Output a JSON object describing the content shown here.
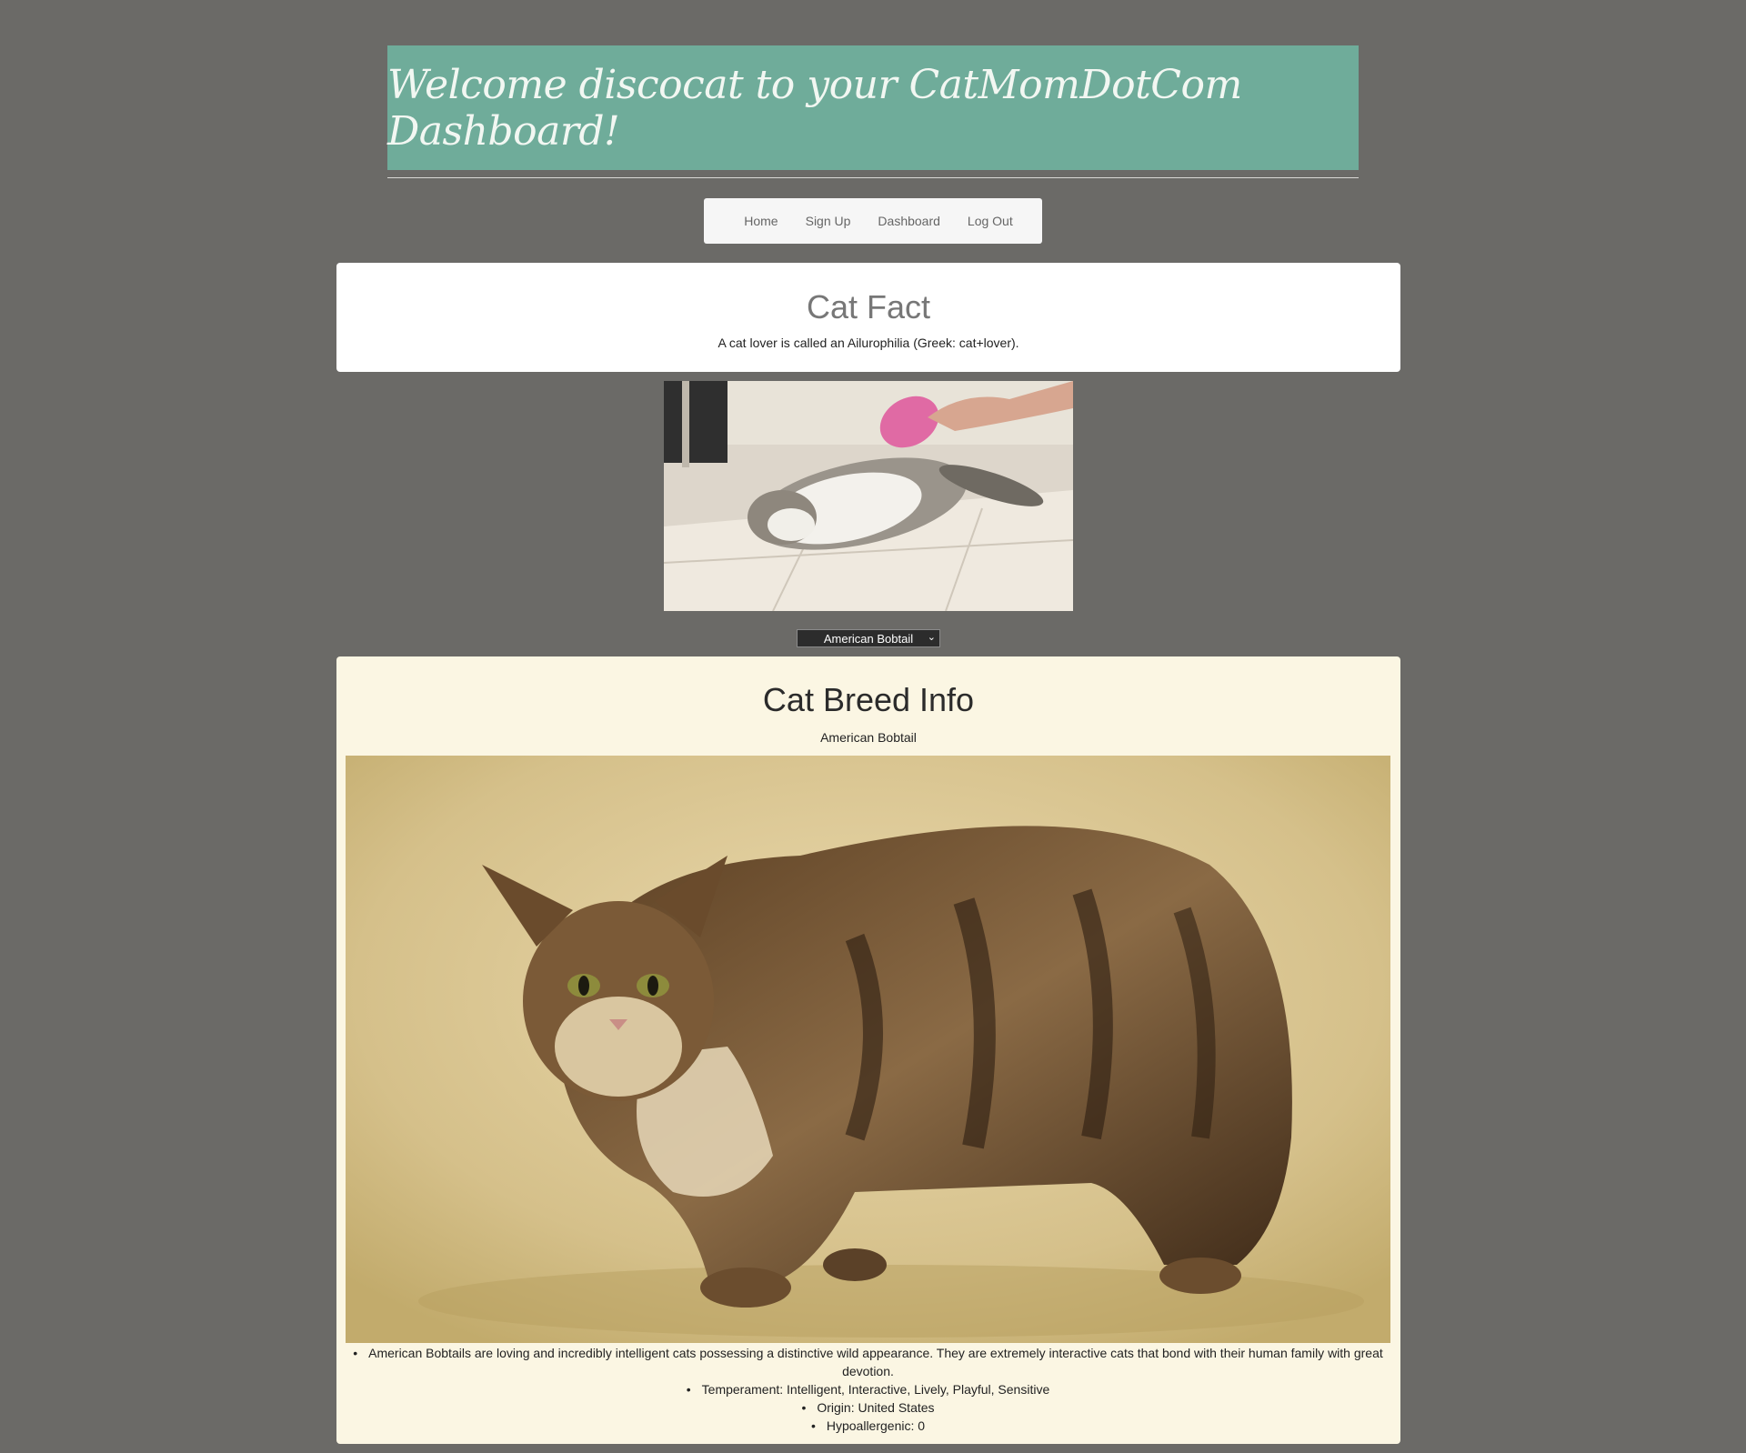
{
  "header": {
    "title": "Welcome discocat to your CatMomDotCom Dashboard!"
  },
  "nav": {
    "items": [
      "Home",
      "Sign Up",
      "Dashboard",
      "Log Out"
    ]
  },
  "cat_fact": {
    "heading": "Cat Fact",
    "text": "A cat lover is called an Ailurophilia (Greek: cat+lover)."
  },
  "breed_select": {
    "selected": "American Bobtail"
  },
  "breed_info": {
    "heading": "Cat Breed Info",
    "breed_name": "American Bobtail",
    "details": [
      "American Bobtails are loving and incredibly intelligent cats possessing a distinctive wild appearance. They are extremely interactive cats that bond with their human family with great devotion.",
      "Temperament: Intelligent, Interactive, Lively, Playful, Sensitive",
      "Origin: United States",
      "Hypoallergenic: 0"
    ]
  },
  "colors": {
    "page_background": "#6b6a67",
    "banner": "#6fac9a",
    "breed_card": "#fbf6e3"
  }
}
